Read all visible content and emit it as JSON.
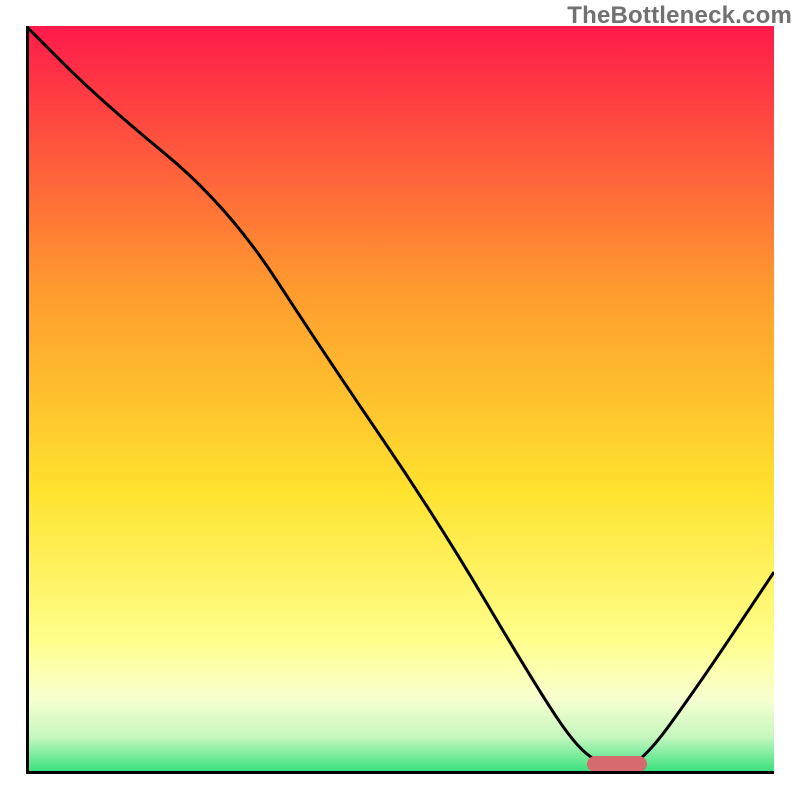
{
  "attribution": "TheBottleneck.com",
  "colors": {
    "top": "#ff1a4b",
    "mid_upper": "#ff9a2e",
    "mid": "#ffe22e",
    "mid_lower": "#ffff8a",
    "low_pale": "#f8ffd0",
    "green_pale": "#c6f7bf",
    "green": "#2fe07a",
    "marker": "#d66b6e",
    "axis": "#000000",
    "curve": "#000000"
  },
  "chart_data": {
    "type": "line",
    "title": "",
    "xlabel": "",
    "ylabel": "",
    "xlim": [
      0,
      100
    ],
    "ylim": [
      0,
      100
    ],
    "series": [
      {
        "name": "bottleneck-curve",
        "x": [
          0,
          10,
          27,
          40,
          55,
          68,
          74,
          78,
          82,
          90,
          100
        ],
        "values": [
          100,
          90,
          76,
          56,
          34,
          12,
          3,
          1,
          1,
          12,
          27
        ]
      }
    ],
    "optimal_region_x": [
      75,
      83
    ],
    "gradient_stops_pct": [
      {
        "pct": 0,
        "key": "top"
      },
      {
        "pct": 35,
        "key": "mid_upper"
      },
      {
        "pct": 62,
        "key": "mid"
      },
      {
        "pct": 82,
        "key": "mid_lower"
      },
      {
        "pct": 90,
        "key": "low_pale"
      },
      {
        "pct": 95,
        "key": "green_pale"
      },
      {
        "pct": 100,
        "key": "green"
      }
    ]
  }
}
